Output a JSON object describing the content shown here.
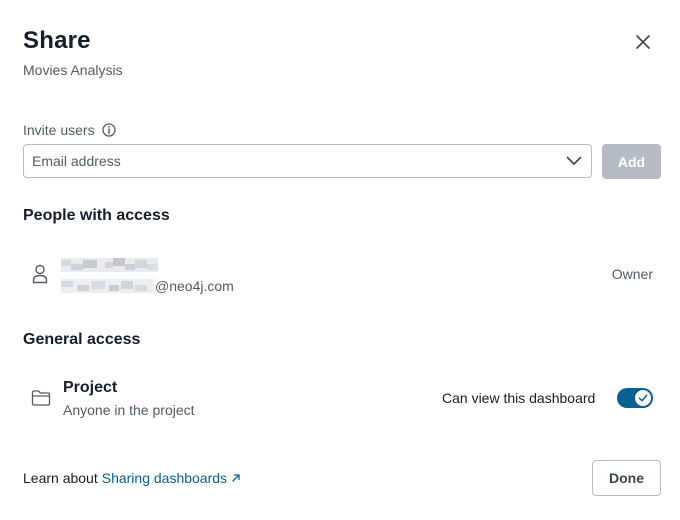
{
  "dialog": {
    "title": "Share",
    "subtitle": "Movies Analysis"
  },
  "invite": {
    "label": "Invite users",
    "placeholder": "Email address",
    "add_label": "Add"
  },
  "people": {
    "heading": "People with access",
    "items": [
      {
        "email_suffix": "@neo4j.com",
        "role": "Owner"
      }
    ]
  },
  "general_access": {
    "heading": "General access",
    "title": "Project",
    "description": "Anyone in the project",
    "toggle_label": "Can view this dashboard",
    "toggle_on": true
  },
  "footer": {
    "learn_text": "Learn about",
    "link_text": "Sharing dashboards",
    "done_label": "Done"
  },
  "colors": {
    "primary": "#0a6190",
    "disabled_button": "#b7bcc4",
    "text": "#151e29",
    "muted_text": "#535b66"
  },
  "icons": {
    "close": "close-icon",
    "info": "info-icon",
    "dropdown": "chevron-down-icon",
    "person": "user-icon",
    "folder": "folder-icon",
    "external": "external-link-icon",
    "check": "check-icon"
  }
}
